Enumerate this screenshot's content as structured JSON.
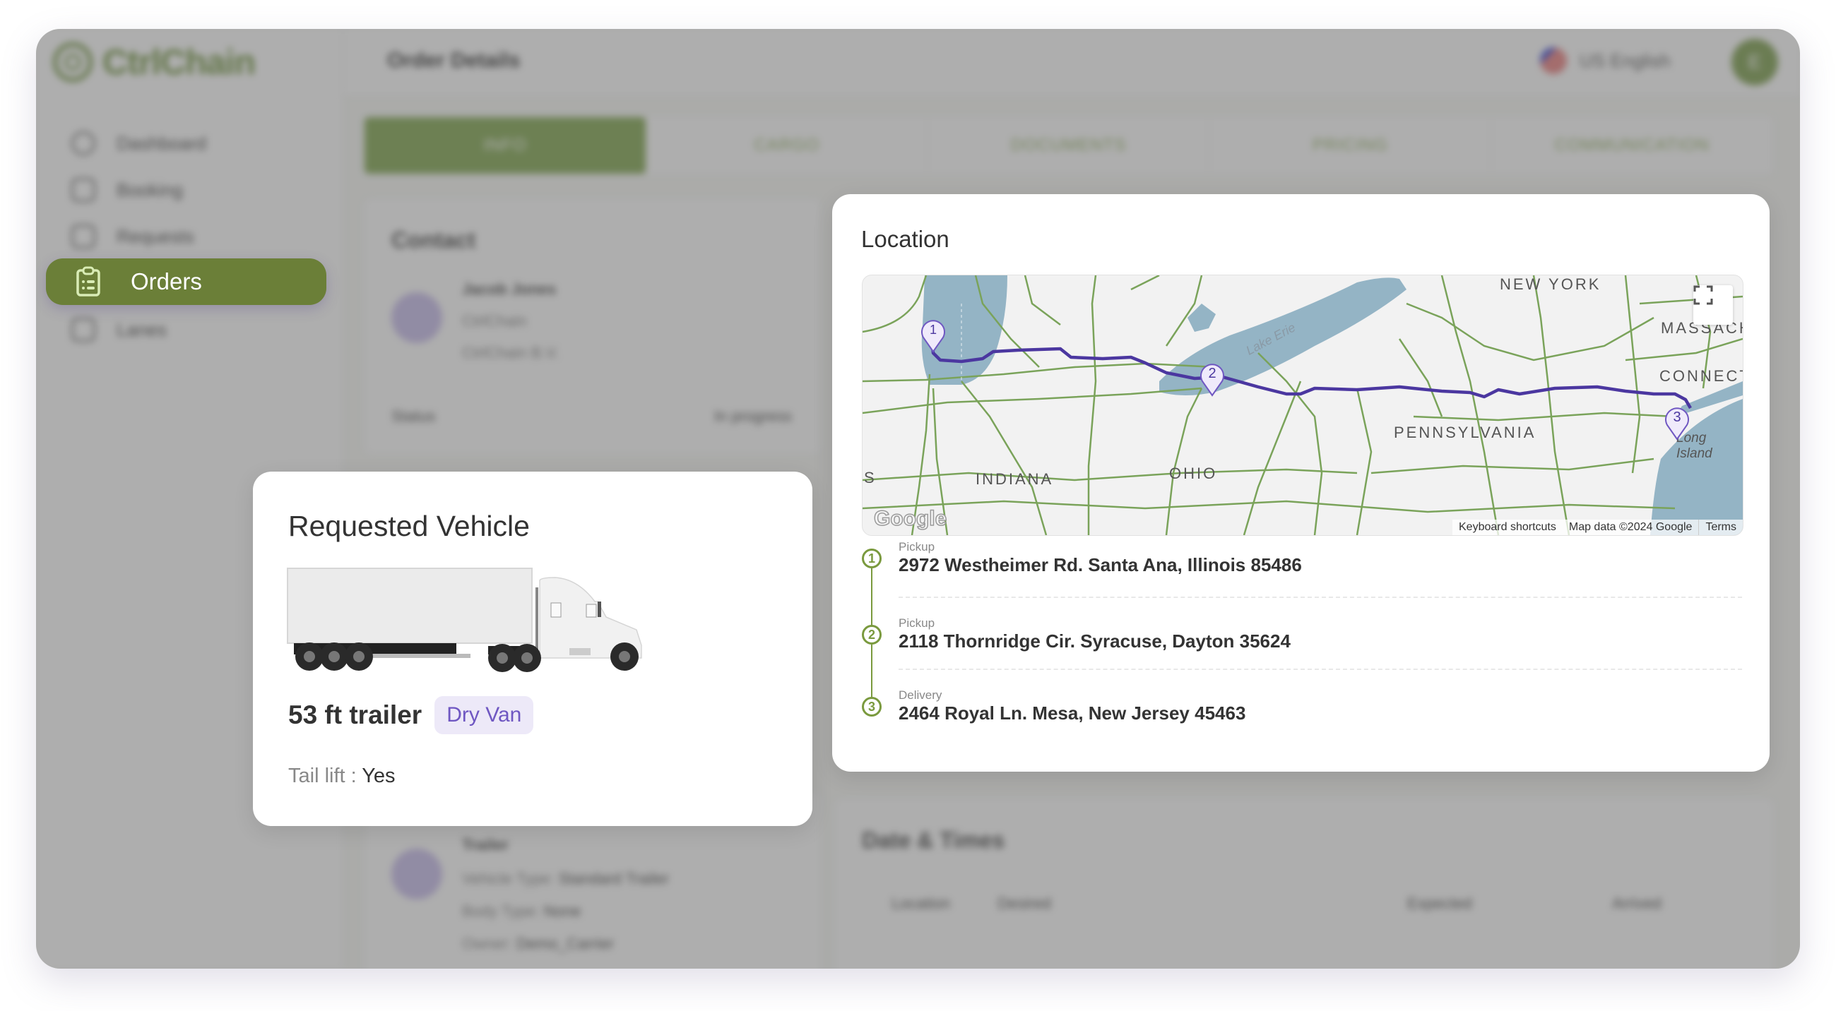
{
  "app": {
    "brand": "CtrlChain",
    "page_title": "Order Details",
    "language": "US English",
    "avatar_initial": "E",
    "colors": {
      "brand_green": "#6b7f38",
      "accent_purple": "#4b37a0",
      "badge_purple_bg": "#ede9f8"
    }
  },
  "sidebar": {
    "items": [
      {
        "label": "Dashboard",
        "icon": "dashboard-icon"
      },
      {
        "label": "Booking",
        "icon": "booking-icon"
      },
      {
        "label": "Requests",
        "icon": "requests-icon"
      },
      {
        "label": "Orders",
        "icon": "clipboard-list-icon",
        "active": true
      },
      {
        "label": "Lanes",
        "icon": "lanes-icon"
      }
    ]
  },
  "tabs": [
    {
      "label": "INFO",
      "active": true
    },
    {
      "label": "CARGO"
    },
    {
      "label": "DOCUMENTS"
    },
    {
      "label": "PRICING"
    },
    {
      "label": "COMMUNICATION"
    }
  ],
  "contact": {
    "title": "Contact",
    "name": "Jacob Jones",
    "company": "CtrlChain",
    "entity": "CtrlChain B.V.",
    "status_label": "Status",
    "status_value": "In progress"
  },
  "trailer": {
    "title": "Trailer",
    "vehicle_type_label": "Vehicle Type:",
    "vehicle_type": "Standard Trailer",
    "body_type_label": "Body Type:",
    "body_type": "None",
    "owner_label": "Owner:",
    "owner": "Demo_Carrier"
  },
  "dates": {
    "title": "Date & Times",
    "columns": [
      "Location",
      "Desired",
      "Expected",
      "Arrived"
    ]
  },
  "requested_vehicle": {
    "title": "Requested Vehicle",
    "size": "53 ft trailer",
    "type_badge": "Dry Van",
    "tail_lift_label": "Tail lift :",
    "tail_lift_value": "Yes"
  },
  "location": {
    "title": "Location",
    "map": {
      "labels": [
        "NEW YORK",
        "MASSACHUSETTS",
        "CONNECTICUT",
        "PENNSYLVANIA",
        "INDIANA",
        "OHIO",
        "Long Island",
        "Lake Erie",
        "S"
      ],
      "attribution": {
        "shortcuts": "Keyboard shortcuts",
        "data": "Map data ©2024 Google",
        "terms": "Terms"
      },
      "logo": "Google",
      "pins": [
        "1",
        "2",
        "3"
      ]
    },
    "stops": [
      {
        "number": "1",
        "type": "Pickup",
        "address": "2972 Westheimer Rd. Santa Ana, Illinois 85486"
      },
      {
        "number": "2",
        "type": "Pickup",
        "address": "2118 Thornridge Cir. Syracuse, Dayton 35624"
      },
      {
        "number": "3",
        "type": "Delivery",
        "address": "2464 Royal Ln. Mesa, New Jersey 45463"
      }
    ]
  }
}
